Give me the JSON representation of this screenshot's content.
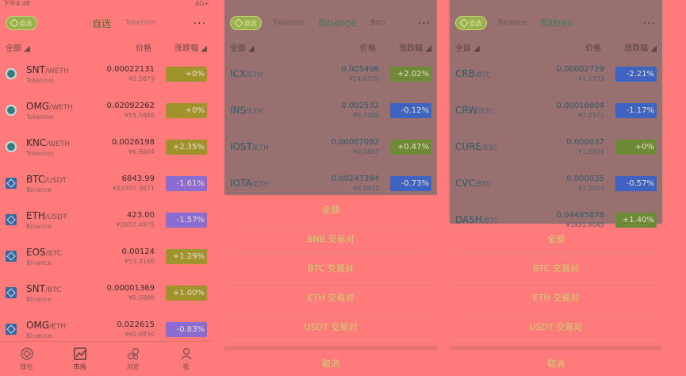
{
  "status": {
    "time": "下午4:48",
    "signal": "4G+"
  },
  "tabs_common": {
    "favorite_pill": "自选",
    "more": "···"
  },
  "colheads": {
    "all": "全部",
    "price": "价格",
    "change": "涨跌幅"
  },
  "panel1": {
    "tabs": [
      "自选",
      "Tokenlon"
    ],
    "rows": [
      {
        "base": "SNT",
        "quote": "/WETH",
        "exchange": "Tokenlon",
        "price": "0.00022131",
        "fiat": "¥0.5879",
        "change": "+0%",
        "dir": "up",
        "icon": "tokenlon-icon"
      },
      {
        "base": "OMG",
        "quote": "/WETH",
        "exchange": "Tokenlon",
        "price": "0.02092262",
        "fiat": "¥55.5886",
        "change": "+0%",
        "dir": "up",
        "icon": "tokenlon-icon"
      },
      {
        "base": "KNC",
        "quote": "/WETH",
        "exchange": "Tokenlon",
        "price": "0.0026198",
        "fiat": "¥6.9604",
        "change": "+2.35%",
        "dir": "up",
        "icon": "tokenlon-icon"
      },
      {
        "base": "BTC",
        "quote": "/USDT",
        "exchange": "Binance",
        "price": "6843.99",
        "fiat": "¥42997.3671",
        "change": "-1.61%",
        "dir": "down",
        "icon": "binance-icon"
      },
      {
        "base": "ETH",
        "quote": "/USDT",
        "exchange": "Binance",
        "price": "423.00",
        "fiat": "¥2657.4975",
        "change": "-1.57%",
        "dir": "down",
        "icon": "binance-icon"
      },
      {
        "base": "EOS",
        "quote": "/BTC",
        "exchange": "Binance",
        "price": "0.00124",
        "fiat": "¥53.3166",
        "change": "+1.29%",
        "dir": "up",
        "icon": "binance-icon"
      },
      {
        "base": "SNT",
        "quote": "/BTC",
        "exchange": "Binance",
        "price": "0.00001369",
        "fiat": "¥0.5886",
        "change": "+1.00%",
        "dir": "up",
        "icon": "binance-icon"
      },
      {
        "base": "OMG",
        "quote": "/ETH",
        "exchange": "Binance",
        "price": "0.022615",
        "fiat": "¥60.0850",
        "change": "-0.83%",
        "dir": "down",
        "icon": "binance-icon"
      }
    ],
    "nav": [
      "钱包",
      "市场",
      "浏览",
      "我"
    ]
  },
  "panel2": {
    "tabs": [
      "Tokenlon",
      "Binance",
      "Bittr"
    ],
    "rows": [
      {
        "base": "ICX",
        "quote": "/ETH",
        "price": "0.005496",
        "fiat": "¥14.6270",
        "change": "+2.02%",
        "dir": "up"
      },
      {
        "base": "INS",
        "quote": "/ETH",
        "price": "0.002532",
        "fiat": "¥6.7386",
        "change": "-0.12%",
        "dir": "down"
      },
      {
        "base": "IOST",
        "quote": "/ETH",
        "price": "0.00007092",
        "fiat": "¥0.1887",
        "change": "+0.47%",
        "dir": "up"
      },
      {
        "base": "IOTA",
        "quote": "/ETH",
        "price": "0.00247394",
        "fiat": "¥6.5841",
        "change": "-0.73%",
        "dir": "down"
      }
    ],
    "sheet": [
      "全部",
      "BNB 交易对",
      "BTC 交易对",
      "ETH 交易对",
      "USDT 交易对"
    ],
    "cancel": "取消"
  },
  "panel3": {
    "tabs": [
      "Binance",
      "Bittrex"
    ],
    "rows": [
      {
        "base": "CRB",
        "quote": "/BTC",
        "price": "0.00002729",
        "fiat": "¥1.1733",
        "change": "-2.21%",
        "dir": "down"
      },
      {
        "base": "CRW",
        "quote": "/BTC",
        "price": "0.00016804",
        "fiat": "¥7.2372",
        "change": "-1.17%",
        "dir": "down"
      },
      {
        "base": "CURE",
        "quote": "/BTC",
        "price": "0.000037",
        "fiat": "¥1.5935",
        "change": "+0%",
        "dir": "up"
      },
      {
        "base": "CVC",
        "quote": "/BTC",
        "price": "0.000035",
        "fiat": "¥1.5074",
        "change": "-0.57%",
        "dir": "down"
      },
      {
        "base": "DASH",
        "quote": "/BTC",
        "price": "0.04485878",
        "fiat": "¥1931.9045",
        "change": "+1.40%",
        "dir": "up"
      }
    ],
    "sheet": [
      "全部",
      "BTC 交易对",
      "ETH 交易对",
      "USDT 交易对"
    ],
    "cancel": "取消"
  }
}
